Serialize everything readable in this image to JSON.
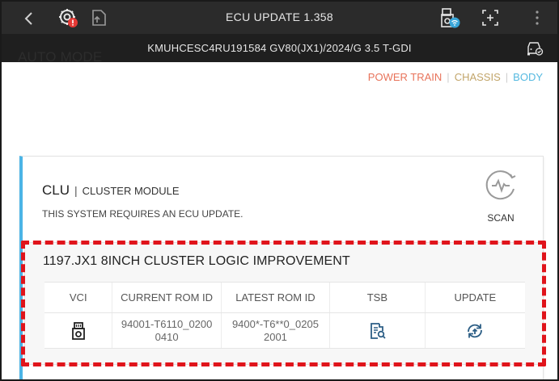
{
  "header": {
    "title": "ECU UPDATE 1.358",
    "vehicle": "KMUHCESC4RU191584  GV80(JX1)/2024/G 3.5 T-GDI"
  },
  "mode": {
    "title": "AUTO MODE"
  },
  "filters": {
    "power_train": "POWER TRAIN",
    "chassis": "CHASSIS",
    "body": "BODY",
    "separator": "|"
  },
  "system": {
    "code": "CLU",
    "separator": "|",
    "name": "CLUSTER MODULE",
    "message": "THIS SYSTEM REQUIRES AN ECU UPDATE.",
    "scan_label": "SCAN"
  },
  "update": {
    "title": "1197.JX1 8INCH CLUSTER LOGIC IMPROVEMENT",
    "columns": [
      "VCI",
      "CURRENT ROM ID",
      "LATEST ROM ID",
      "TSB",
      "UPDATE"
    ],
    "row": {
      "current_rom_line1": "94001-T6110_0200",
      "current_rom_line2": "0410",
      "latest_rom_line1": "9400*-T6**0_0205",
      "latest_rom_line2": "2001"
    }
  },
  "colors": {
    "accent_blue": "#4bb4e6",
    "power_train": "#e8735a",
    "chassis": "#c2a56a",
    "body": "#55b9e0",
    "highlight_red": "#e0141b",
    "status_red": "#e53935"
  },
  "icons": {
    "back": "chevron-left-icon",
    "diagnostics": "gear-alert-icon",
    "export": "file-export-icon",
    "vci_status": "vci-wifi-icon",
    "screenshot": "capture-icon",
    "more": "more-vert-icon",
    "vehicle": "car-check-icon",
    "scan": "scan-waveform-icon",
    "vci": "vci-device-icon",
    "tsb": "document-search-icon",
    "update": "update-arrow-icon"
  }
}
